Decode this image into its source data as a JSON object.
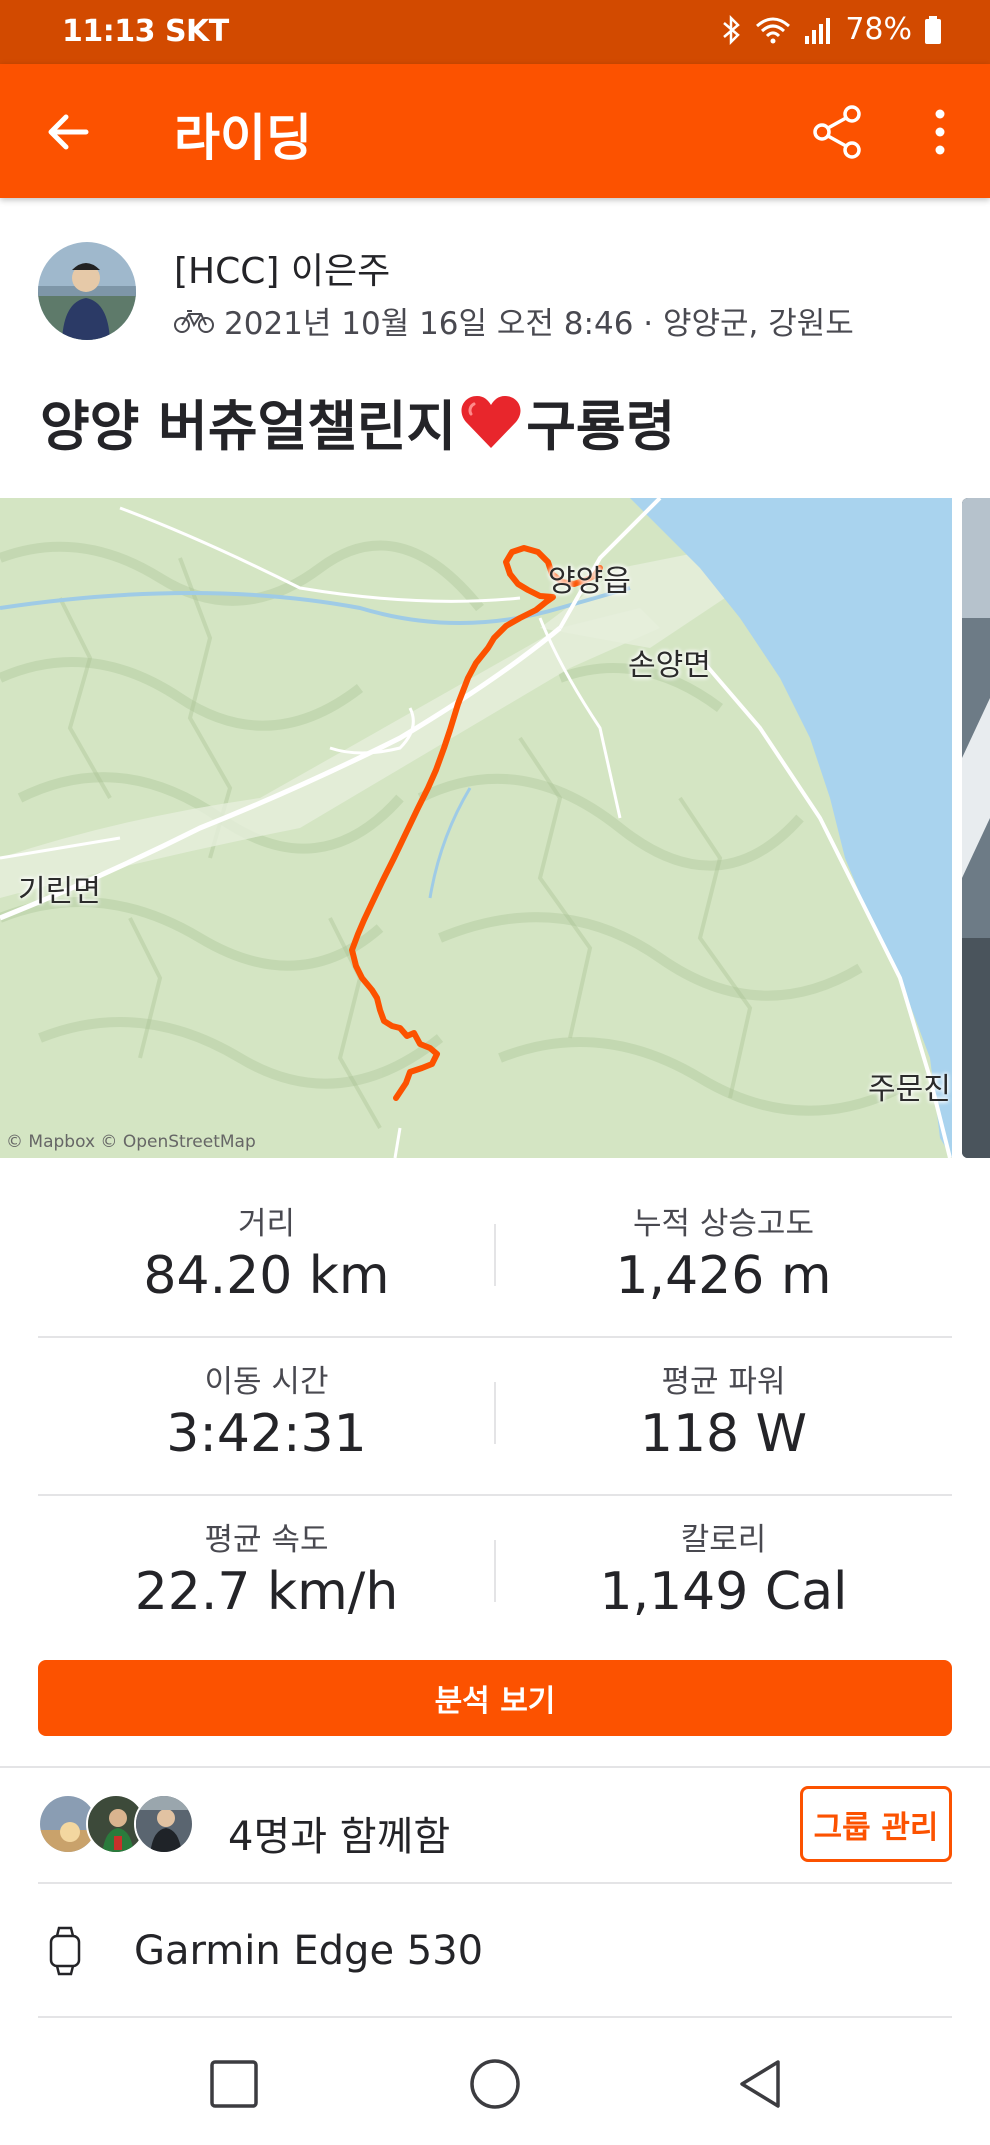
{
  "status_bar": {
    "time": "11:13 SKT",
    "battery": "78%"
  },
  "app_bar": {
    "title": "라이딩",
    "icons": [
      "back-arrow-icon",
      "share-icon",
      "more-vert-icon"
    ]
  },
  "athlete": {
    "name": "[HCC] 이은주",
    "activity_icon": "bike-icon",
    "meta": "2021년 10월 16일 오전 8:46 · 양양군, 강원도"
  },
  "activity": {
    "title_part1": "양양 버츄얼챌린지",
    "title_part2": "구룡령"
  },
  "map": {
    "labels": {
      "yangyang": "양양읍",
      "sonyang": "손양면",
      "girin": "기린면",
      "jumun": "주문진"
    },
    "credit": "© Mapbox © OpenStreetMap",
    "route_color": "#fc5200",
    "water_color": "#a9d3ee"
  },
  "stats": {
    "distance_label": "거리",
    "distance_value": "84.20 km",
    "elevation_label": "누적 상승고도",
    "elevation_value": "1,426 m",
    "moving_time_label": "이동 시간",
    "moving_time_value": "3:42:31",
    "avg_power_label": "평균 파워",
    "avg_power_value": "118 W",
    "avg_speed_label": "평균 속도",
    "avg_speed_value": "22.7 km/h",
    "calories_label": "칼로리",
    "calories_value": "1,149 Cal"
  },
  "analysis_button": "분석 보기",
  "group": {
    "text": "4명과 함께함",
    "manage_button": "그룹 관리"
  },
  "device": {
    "name": "Garmin Edge 530"
  },
  "colors": {
    "accent": "#fc5200",
    "status_bar": "#d24a00"
  }
}
